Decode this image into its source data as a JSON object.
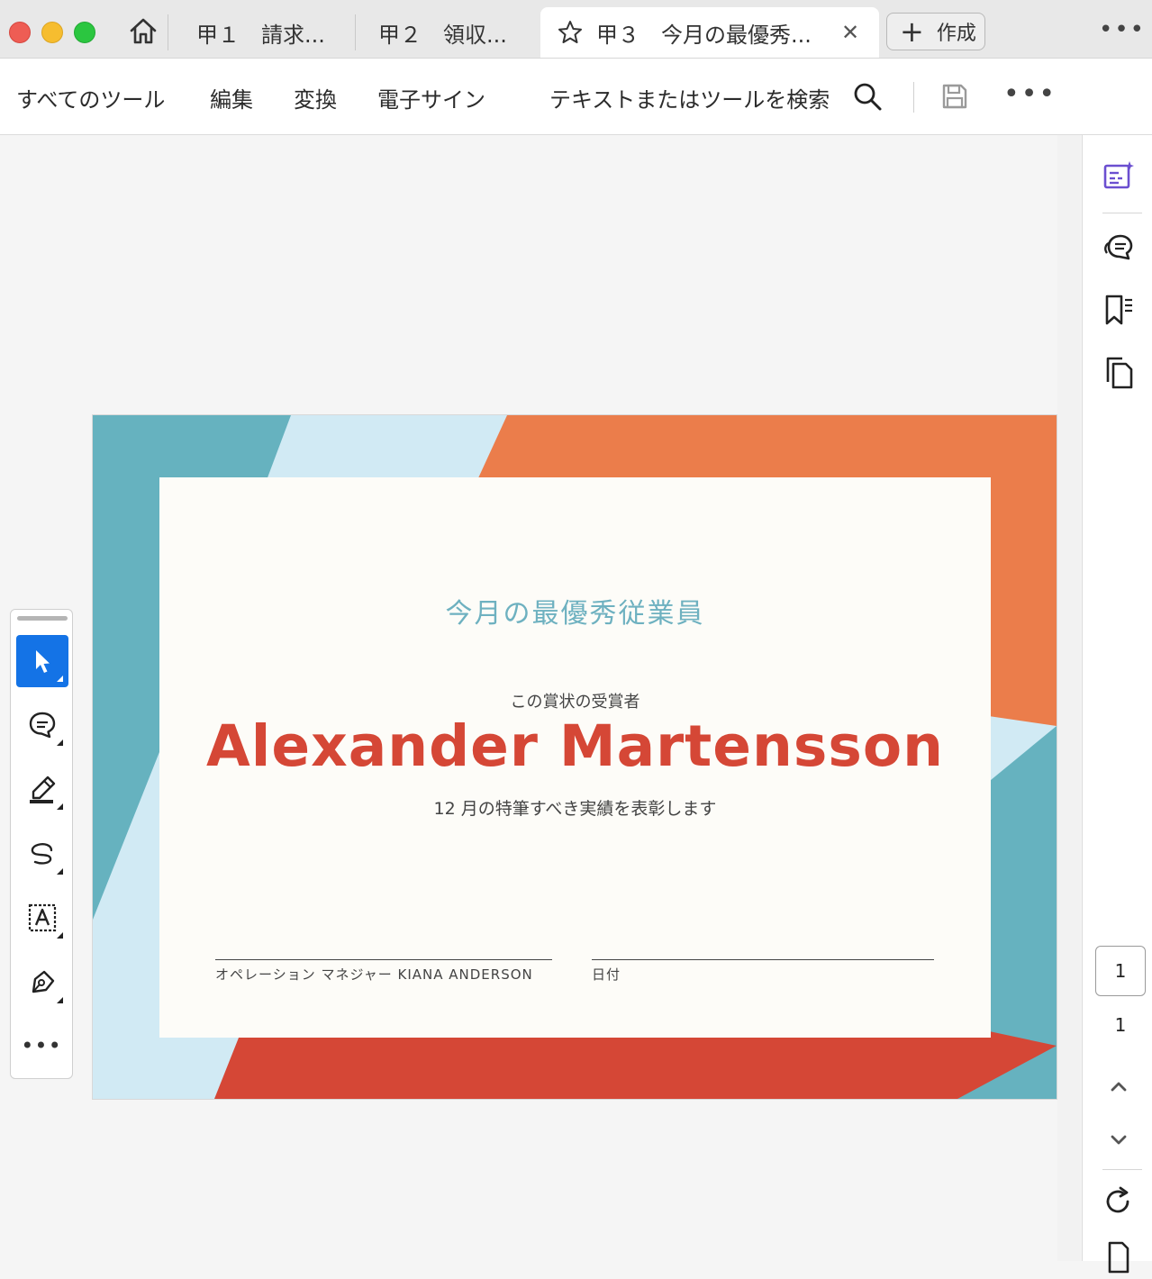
{
  "tabs": [
    {
      "label": "甲１　請求..."
    },
    {
      "label": "甲２　領収..."
    },
    {
      "label": "甲３　今月の最優秀..."
    }
  ],
  "create_button": {
    "label": "作成"
  },
  "toolbar": {
    "all_tools": "すべてのツール",
    "edit": "編集",
    "convert": "変換",
    "esign": "電子サイン",
    "search": "テキストまたはツールを検索"
  },
  "certificate": {
    "title": "今月の最優秀従業員",
    "subtitle": "この賞状の受賞者",
    "name": "Alexander Martensson",
    "description": "12 月の特筆すべき実績を表彰します",
    "signature_label": "オペレーション マネジャー KIANA ANDERSON",
    "date_label": "日付"
  },
  "page_nav": {
    "current": "1",
    "total": "1"
  },
  "colors": {
    "teal": "#66b2bf",
    "light_blue": "#d1eaf4",
    "orange": "#eb7d4b",
    "red": "#d54736",
    "accent_blue": "#1473e6",
    "rail_purple": "#6b4fd0"
  },
  "icons": [
    "home-icon",
    "star-icon",
    "close-icon",
    "plus-icon",
    "search-icon",
    "save-icon",
    "more-icon",
    "select-icon",
    "comment-icon",
    "highlight-icon",
    "draw-icon",
    "text-box-icon",
    "sign-icon",
    "ai-assistant-icon",
    "comments-panel-icon",
    "bookmarks-icon",
    "pages-icon",
    "chevron-up-icon",
    "chevron-down-icon",
    "refresh-icon",
    "page-fit-icon"
  ]
}
